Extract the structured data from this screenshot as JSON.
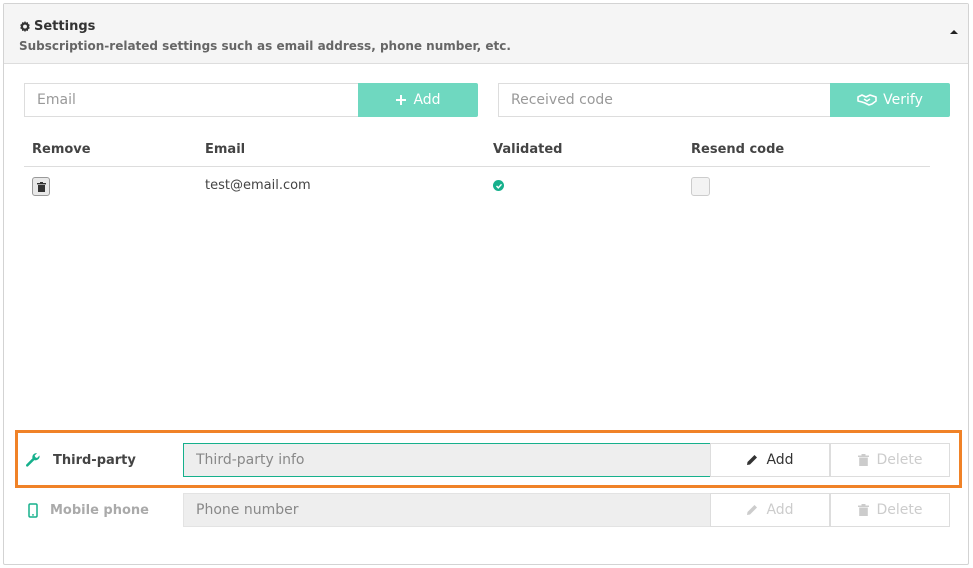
{
  "panel": {
    "title": "Settings",
    "subtitle": "Subscription-related settings such as email address, phone number, etc."
  },
  "email_form": {
    "email_placeholder": "Email",
    "add_label": "Add",
    "code_placeholder": "Received code",
    "verify_label": "Verify"
  },
  "table": {
    "columns": [
      "Remove",
      "Email",
      "Validated",
      "Resend code"
    ],
    "rows": [
      {
        "email": "test@email.com",
        "validated": true,
        "resend": false
      }
    ]
  },
  "third_party": {
    "label": "Third-party",
    "placeholder": "Third-party info",
    "add_label": "Add",
    "delete_label": "Delete"
  },
  "mobile": {
    "label": "Mobile phone",
    "placeholder": "Phone number",
    "add_label": "Add",
    "delete_label": "Delete"
  },
  "colors": {
    "accent": "#6fd8c0",
    "success": "#16b08c",
    "highlight": "#f08227"
  },
  "icons": {
    "settings": "gear-icon",
    "collapse": "caret-up-icon",
    "add": "plus-icon",
    "verify": "handshake-icon",
    "remove": "trash-icon",
    "validated": "check-circle-icon",
    "third_party": "wrench-icon",
    "mobile": "mobile-phone-icon",
    "edit": "pencil-icon",
    "delete": "trash-icon"
  }
}
